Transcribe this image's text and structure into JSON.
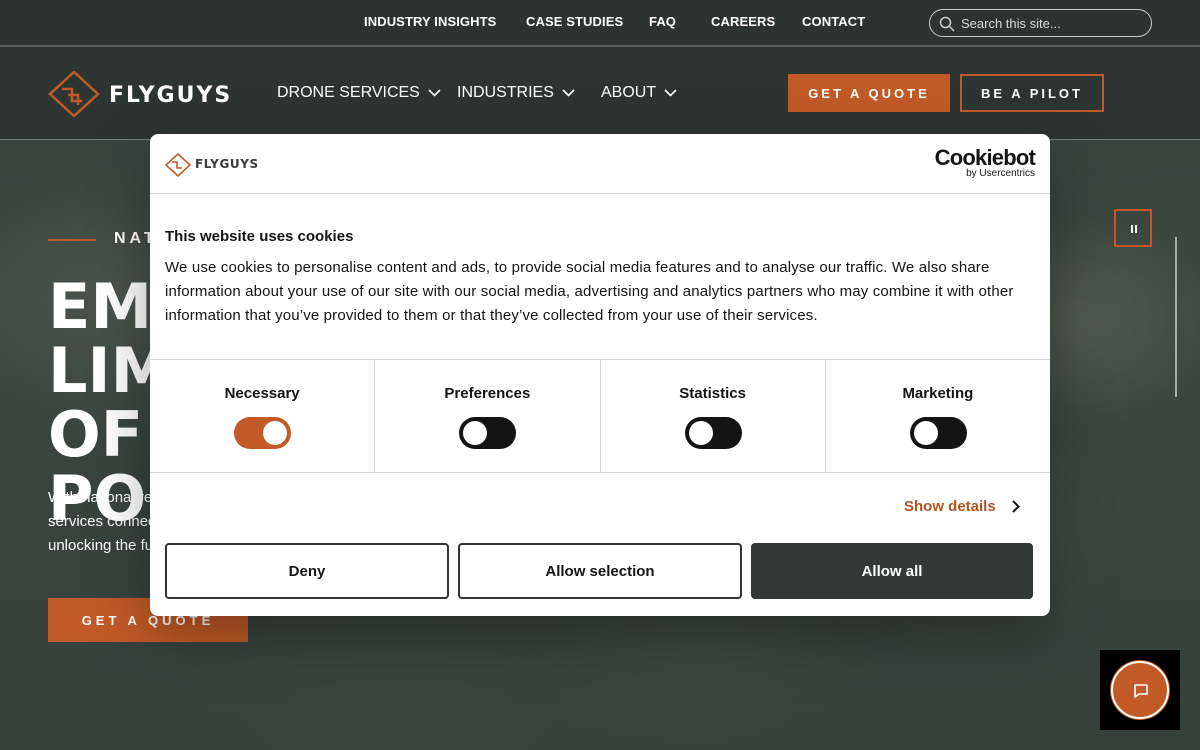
{
  "utility_nav": {
    "links": [
      "INDUSTRY INSIGHTS",
      "CASE STUDIES",
      "FAQ",
      "CAREERS",
      "CONTACT"
    ],
    "search_placeholder": "Search this site..."
  },
  "main_nav": {
    "logo_text": "FLYGUYS",
    "items": [
      "DRONE SERVICES",
      "INDUSTRIES",
      "ABOUT"
    ],
    "quote_button": "GET A QUOTE",
    "pilot_button": "BE A PILOT"
  },
  "hero": {
    "eyebrow": "NATIONWIDE",
    "title_lines": [
      "EMPOWER",
      "LIMITLESS",
      "OF POSSIBILITIES"
    ],
    "body_lines": [
      "With national reach and",
      "services connect you",
      "unlocking the future"
    ],
    "cta": "GET A QUOTE"
  },
  "cookie_dialog": {
    "logo_text": "FLYGUYS",
    "brand_main": "Cookiebot",
    "brand_sub": "by Usercentrics",
    "title": "This website uses cookies",
    "text": "We use cookies to personalise content and ads, to provide social media features and to analyse our traffic. We also share information about your use of our site with our social media, advertising and analytics partners who may combine it with other information that you’ve provided to them or that they’ve collected from your use of their services.",
    "categories": [
      {
        "label": "Necessary",
        "enabled": true
      },
      {
        "label": "Preferences",
        "enabled": false
      },
      {
        "label": "Statistics",
        "enabled": false
      },
      {
        "label": "Marketing",
        "enabled": false
      }
    ],
    "show_details": "Show details",
    "deny": "Deny",
    "allow_selection": "Allow selection",
    "allow_all": "Allow all"
  },
  "colors": {
    "accent": "#c25a27",
    "dark": "#2c3431",
    "allow_all_bg": "#333936"
  },
  "icons": [
    "search-icon",
    "chevron-down-icon",
    "pause-icon",
    "chat-icon",
    "chevron-right-icon",
    "flyguys-logo-icon"
  ]
}
